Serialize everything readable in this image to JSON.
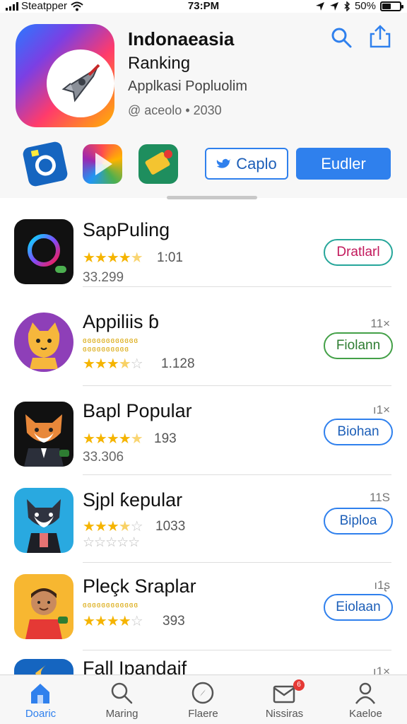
{
  "status_bar": {
    "carrier": "Steatpper",
    "time": "73:PM",
    "battery": "50%",
    "battery_level": 0.5
  },
  "header": {
    "title": "Indonaeasia",
    "subtitle": "Ranking",
    "category": "Applkasi Popluolim",
    "meta": "@ aceolo • 2030",
    "buttons": {
      "outline_label": "Caplo",
      "solid_label": "Eudler"
    },
    "icons": [
      "search-icon",
      "share-icon",
      "camera-app-icon",
      "play-store-icon",
      "green-app-icon"
    ]
  },
  "list": {
    "items": [
      {
        "name": "SapPuling",
        "tiny": "",
        "stars": 4.5,
        "rating": "1:01",
        "sub": "33.299",
        "rank": "",
        "button": "Dratlarl",
        "button_color": "#c2185b",
        "icon": "ring-icon"
      },
      {
        "name": "Appiliis ɓ",
        "tiny": "ɞɞɞɞɞɞɞɞɞɞɞɞ\nɞɞɞɞɞɞɞɞɞɞ",
        "stars": 3.5,
        "rating": "1.128",
        "sub": "",
        "rank": "11×",
        "button": "Fiolann",
        "button_color": "#2e7d32",
        "icon": "cat-icon"
      },
      {
        "name": "Bapl Popular",
        "tiny": "",
        "stars": 4.5,
        "rating": "193",
        "sub": "33.306",
        "rank": "ı1×",
        "button": "Biohan",
        "button_color": "#1d5fb8",
        "icon": "fox-icon"
      },
      {
        "name": "Sjpl ƙepular",
        "tiny": "",
        "stars": 3.5,
        "rating": "1033",
        "sub": "☆☆☆☆☆",
        "rank": "11S",
        "button": "Biploa",
        "button_color": "#1d5fb8",
        "icon": "wolf-icon"
      },
      {
        "name": "Pleçk Sraplar",
        "tiny": "ɞɞɞɞɞɞɞɞɞɞɞɞ",
        "stars": 4.5,
        "rating": "393",
        "sub": "",
        "rank": "ı1ʂ",
        "button": "Eiolaan",
        "button_color": "#1d5fb8",
        "icon": "boy-icon"
      },
      {
        "name": "Fall Ipandaif",
        "tiny": "",
        "stars": 0,
        "rating": "",
        "sub": "",
        "rank": "ı1×",
        "button": "",
        "button_color": "#1d5fb8",
        "icon": "moon-icon"
      }
    ]
  },
  "tabbar": {
    "tabs": [
      {
        "label": "Doaric",
        "icon": "home-icon",
        "active": true
      },
      {
        "label": "Maring",
        "icon": "search-icon",
        "active": false
      },
      {
        "label": "Flaere",
        "icon": "compass-icon",
        "active": false
      },
      {
        "label": "Nissiras",
        "icon": "mail-icon",
        "active": false,
        "badge": "6"
      },
      {
        "label": "Kaeloe",
        "icon": "profile-icon",
        "active": false
      }
    ]
  },
  "colors": {
    "accent": "#2f80ed",
    "star": "#f5b400"
  }
}
